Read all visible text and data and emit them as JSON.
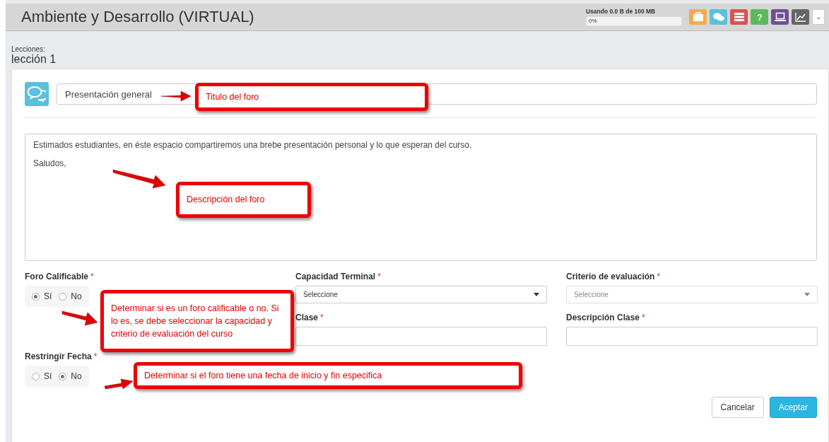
{
  "header": {
    "title": "Ambiente y Desarrollo (VIRTUAL)",
    "storage": {
      "label": "Usando 0.0 B de 100 MB",
      "reading": "0%",
      "level": 0
    },
    "toolbar": [
      {
        "color": "#f0ad4e"
      },
      {
        "color": "#5bc0de"
      },
      {
        "color": "#d9534f"
      },
      {
        "color": "#5cb85c",
        "glyph": "?"
      },
      {
        "color": "#6f4e9c"
      },
      {
        "color": "#666666"
      }
    ],
    "menu_caret": "⌄"
  },
  "lesson": {
    "label": "Lecciones:",
    "name": "lección 1"
  },
  "forum": {
    "title_value": "Presentación general",
    "description": [
      "Estimados estudiantes, en éste espacio compartiremos una brebe presentación personal y lo que esperan del curso.",
      "Saludos,"
    ]
  },
  "fields": [
    {
      "kind": "radio",
      "label": "Foro Calificable",
      "required": "*",
      "options": [
        {
          "label": "Sí",
          "selected": true
        },
        {
          "label": "No",
          "selected": false
        }
      ]
    },
    {
      "kind": "select",
      "label": "Capacidad Terminal",
      "required": "*",
      "placeholder": "Seleccione",
      "disabled": false
    },
    {
      "kind": "select",
      "label": "Criterio de evaluación",
      "required": "*",
      "placeholder": "Seleccione",
      "disabled": true
    },
    {
      "kind": "spacer"
    },
    {
      "kind": "input",
      "label": "Clase",
      "required": "*"
    },
    {
      "kind": "input",
      "label": "Descripción Clase",
      "required": "*"
    },
    {
      "kind": "radio",
      "label": "Restringir Fecha",
      "required": "*",
      "options": [
        {
          "label": "Sí",
          "selected": false
        },
        {
          "label": "No",
          "selected": true
        }
      ]
    }
  ],
  "buttons": [
    {
      "label": "Cancelar",
      "kind": "default"
    },
    {
      "label": "Aceptar",
      "kind": "primary"
    }
  ],
  "annotations": [
    "Titulo del foro",
    "Descripción del foro",
    "Determinar si es un foro calificable o no. Si lo es, se debe seleccionar la capacidad y criterio de evaluación del curso",
    "Determinar si el foro tiene una fecha de inicio y fin especifica"
  ]
}
